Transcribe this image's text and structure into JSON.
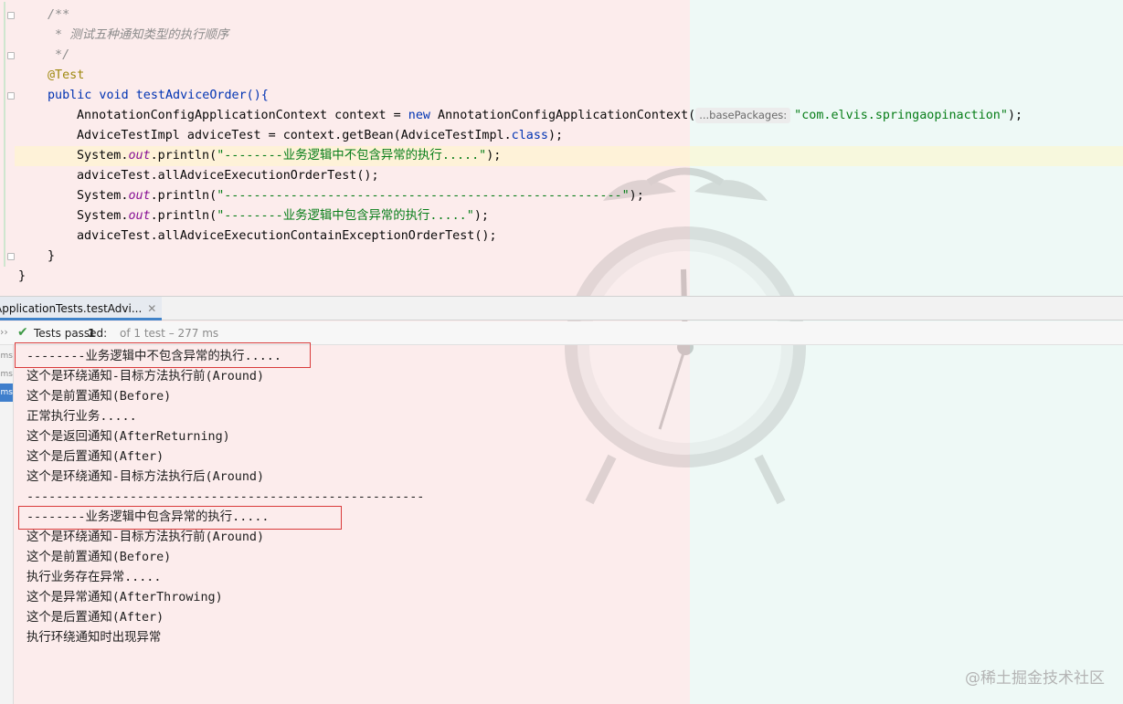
{
  "editor": {
    "lines": [
      "/**",
      " * 测试五种通知类型的执行顺序",
      " */",
      "@Test",
      "public void testAdviceOrder(){"
    ],
    "line6": {
      "p1": "AnnotationConfigApplicationContext context = ",
      "kw": "new",
      "p2": " AnnotationConfigApplicationContext(",
      "hint": "...basePackages:",
      "str": "\"com.elvis.springaopinaction\"",
      "p3": ");"
    },
    "line7": {
      "p1": "AdviceTestImpl adviceTest = context.getBean(AdviceTestImpl.",
      "kw": "class",
      "p2": ");"
    },
    "line8": {
      "p1": "System.",
      "field": "out",
      "p2": ".println(",
      "str": "\"--------业务逻辑中不包含异常的执行.....\"",
      "p3": ");"
    },
    "line9": "adviceTest.allAdviceExecutionOrderTest();",
    "line10": {
      "p1": "System.",
      "field": "out",
      "p2": ".println(",
      "str": "\"------------------------------------------------------\"",
      "p3": ");"
    },
    "line11": {
      "p1": "System.",
      "field": "out",
      "p2": ".println(",
      "str": "\"--------业务逻辑中包含异常的执行.....\"",
      "p3": ");"
    },
    "line12": "adviceTest.allAdviceExecutionContainExceptionOrderTest();",
    "line13": "}",
    "line14": "}"
  },
  "run_panel": {
    "tab_label": "ApplicationTests.testAdvi...",
    "status": {
      "label": "Tests passed:",
      "count": "1",
      "detail": "of 1 test – 277 ms"
    },
    "strip": [
      "ms",
      "ms",
      "ms"
    ],
    "console": [
      "--------业务逻辑中不包含异常的执行.....",
      "这个是环绕通知-目标方法执行前(Around)",
      "这个是前置通知(Before)",
      "正常执行业务.....",
      "这个是返回通知(AfterReturning)",
      "这个是后置通知(After)",
      "这个是环绕通知-目标方法执行后(Around)",
      "------------------------------------------------------",
      "--------业务逻辑中包含异常的执行.....",
      "这个是环绕通知-目标方法执行前(Around)",
      "这个是前置通知(Before)",
      "执行业务存在异常.....",
      "这个是异常通知(AfterThrowing)",
      "这个是后置通知(After)",
      "执行环绕通知时出现异常"
    ]
  },
  "watermark": "@稀土掘金技术社区",
  "icons": {
    "check": "check-icon",
    "close": "close-icon",
    "expand": "chevron-double-right-icon",
    "fold": "fold-marker-icon",
    "clock": "alarm-clock-icon"
  },
  "colors": {
    "keyword": "#0033b3",
    "string": "#067d17",
    "annotation": "#9e880d",
    "comment": "#8c8c8c",
    "field": "#871094",
    "pass": "#3d9a45",
    "highlight_box": "#d93a3a"
  }
}
